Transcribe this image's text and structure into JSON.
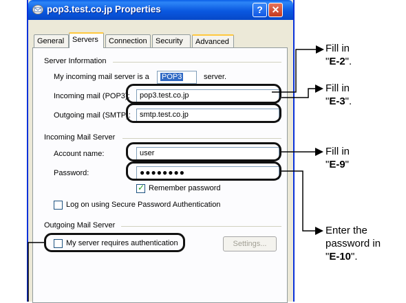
{
  "window": {
    "title": "pop3.test.co.jp Properties",
    "help_glyph": "?",
    "close_glyph": "✕"
  },
  "tabs": [
    {
      "label": "General"
    },
    {
      "label": "Servers"
    },
    {
      "label": "Connection"
    },
    {
      "label": "Security"
    },
    {
      "label": "Advanced"
    }
  ],
  "server_info": {
    "heading": "Server Information",
    "server_type_prefix": "My incoming mail server is a",
    "server_type_value": "POP3",
    "server_type_suffix": "server.",
    "incoming_label": "Incoming mail (POP3):",
    "incoming_value": "pop3.test.co.jp",
    "outgoing_label": "Outgoing mail (SMTP):",
    "outgoing_value": "smtp.test.co.jp"
  },
  "incoming_server": {
    "heading": "Incoming Mail Server",
    "account_label": "Account name:",
    "account_value": "user",
    "password_label": "Password:",
    "password_value": "●●●●●●●●",
    "remember_label": "Remember password",
    "remember_checked": true,
    "spa_label": "Log on using Secure Password Authentication",
    "spa_checked": false
  },
  "outgoing_server": {
    "heading": "Outgoing Mail Server",
    "auth_label": "My server requires authentication",
    "auth_checked": false,
    "settings_label": "Settings..."
  },
  "annotations": {
    "e2_line1": "Fill in",
    "e2_open": "\"",
    "e2_code": "E-2",
    "e2_close": "\".",
    "e3_line1": "Fill in",
    "e3_open": "\"",
    "e3_code": "E-3",
    "e3_close": "\".",
    "e9_line1": "Fill in",
    "e9_open": "\"",
    "e9_code": "E-9",
    "e9_close": "\"",
    "e10_line1": "Enter the",
    "e10_line2": "password in",
    "e10_open": "\"",
    "e10_code": "E-10",
    "e10_close": "\"."
  }
}
